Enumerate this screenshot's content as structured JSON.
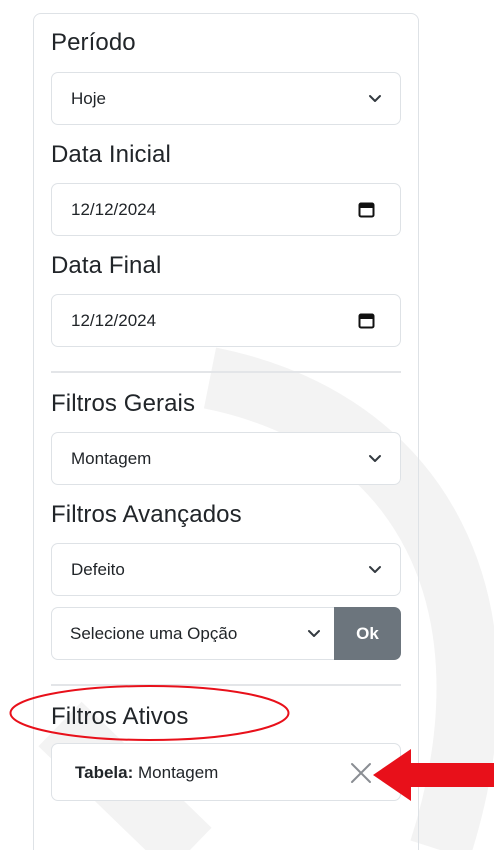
{
  "periodo": {
    "heading": "Período",
    "selected": "Hoje"
  },
  "data_inicial": {
    "heading": "Data Inicial",
    "value": "12/12/2024"
  },
  "data_final": {
    "heading": "Data Final",
    "value": "12/12/2024"
  },
  "filtros_gerais": {
    "heading": "Filtros Gerais",
    "selected": "Montagem"
  },
  "filtros_avancados": {
    "heading": "Filtros Avançados",
    "selected": "Defeito",
    "option_select": "Selecione uma Opção",
    "ok_label": "Ok"
  },
  "filtros_ativos": {
    "heading": "Filtros Ativos",
    "items": [
      {
        "key": "Tabela:",
        "value": "Montagem"
      }
    ]
  },
  "icons": {
    "select": "chevron-down-icon",
    "date": "calendar-icon",
    "remove": "close-icon"
  },
  "colors": {
    "border": "#dee2e6",
    "ok_button": "#6c757d",
    "annotation": "#e8101a",
    "watermark": "#f2f2f2"
  }
}
